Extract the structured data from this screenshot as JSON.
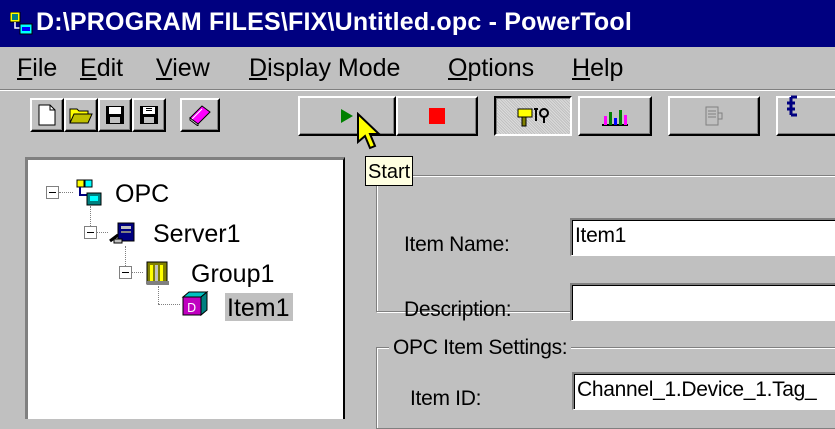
{
  "window": {
    "title": "D:\\PROGRAM FILES\\FIX\\Untitled.opc - PowerTool"
  },
  "menu": {
    "items": [
      {
        "label": "File",
        "key": "F",
        "rest": "ile"
      },
      {
        "label": "Edit",
        "key": "E",
        "rest": "dit"
      },
      {
        "label": "View",
        "key": "V",
        "rest": "iew"
      },
      {
        "label": "Display Mode",
        "key": "D",
        "rest": "isplay Mode"
      },
      {
        "label": "Options",
        "key": "O",
        "rest": "ptions"
      },
      {
        "label": "Help",
        "key": "H",
        "rest": "elp"
      }
    ]
  },
  "toolbar": {
    "buttons": [
      "new-file-icon",
      "open-folder-icon",
      "save-icon",
      "save-as-icon",
      "book-icon",
      "start-icon",
      "stop-icon",
      "tools-icon",
      "bar-chart-icon",
      "document-icon",
      "partial-icon"
    ],
    "pressed": [
      "start",
      "tools"
    ],
    "colors": {
      "start": "#008000",
      "stop": "#ff0000"
    }
  },
  "tooltip": {
    "text": "Start"
  },
  "tree": {
    "nodes": [
      {
        "label": "OPC",
        "level": 0
      },
      {
        "label": "Server1",
        "level": 1
      },
      {
        "label": "Group1",
        "level": 2
      },
      {
        "label": "Item1",
        "level": 3,
        "selected": true
      }
    ]
  },
  "item_box": {
    "name_label": "Item Name:",
    "name_value": "Item1",
    "description_label": "Description:",
    "description_value": ""
  },
  "opc_settings": {
    "title": "OPC Item Settings:",
    "id_label": "Item ID:",
    "id_value": "Channel_1.Device_1.Tag_"
  }
}
